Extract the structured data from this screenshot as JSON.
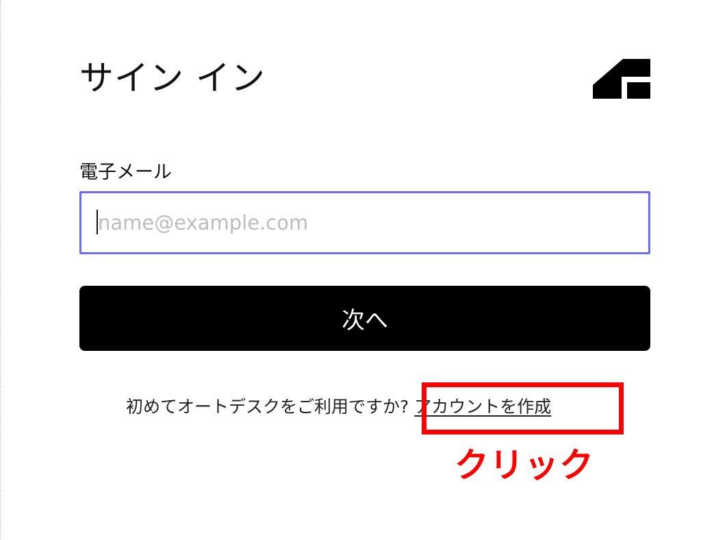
{
  "header": {
    "title": "サイン イン",
    "logo_icon": "autodesk-logo-icon"
  },
  "form": {
    "email_label": "電子メール",
    "email_value": "",
    "email_placeholder": "name@example.com",
    "next_label": "次へ"
  },
  "signup": {
    "prompt": "初めてオートデスクをご利用ですか?",
    "link_label": "アカウントを作成"
  },
  "annotation": {
    "label": "クリック",
    "color": "#ff0000"
  },
  "colors": {
    "input_focus_border": "#6b6bf0",
    "button_background": "#000000",
    "button_text": "#ffffff"
  }
}
